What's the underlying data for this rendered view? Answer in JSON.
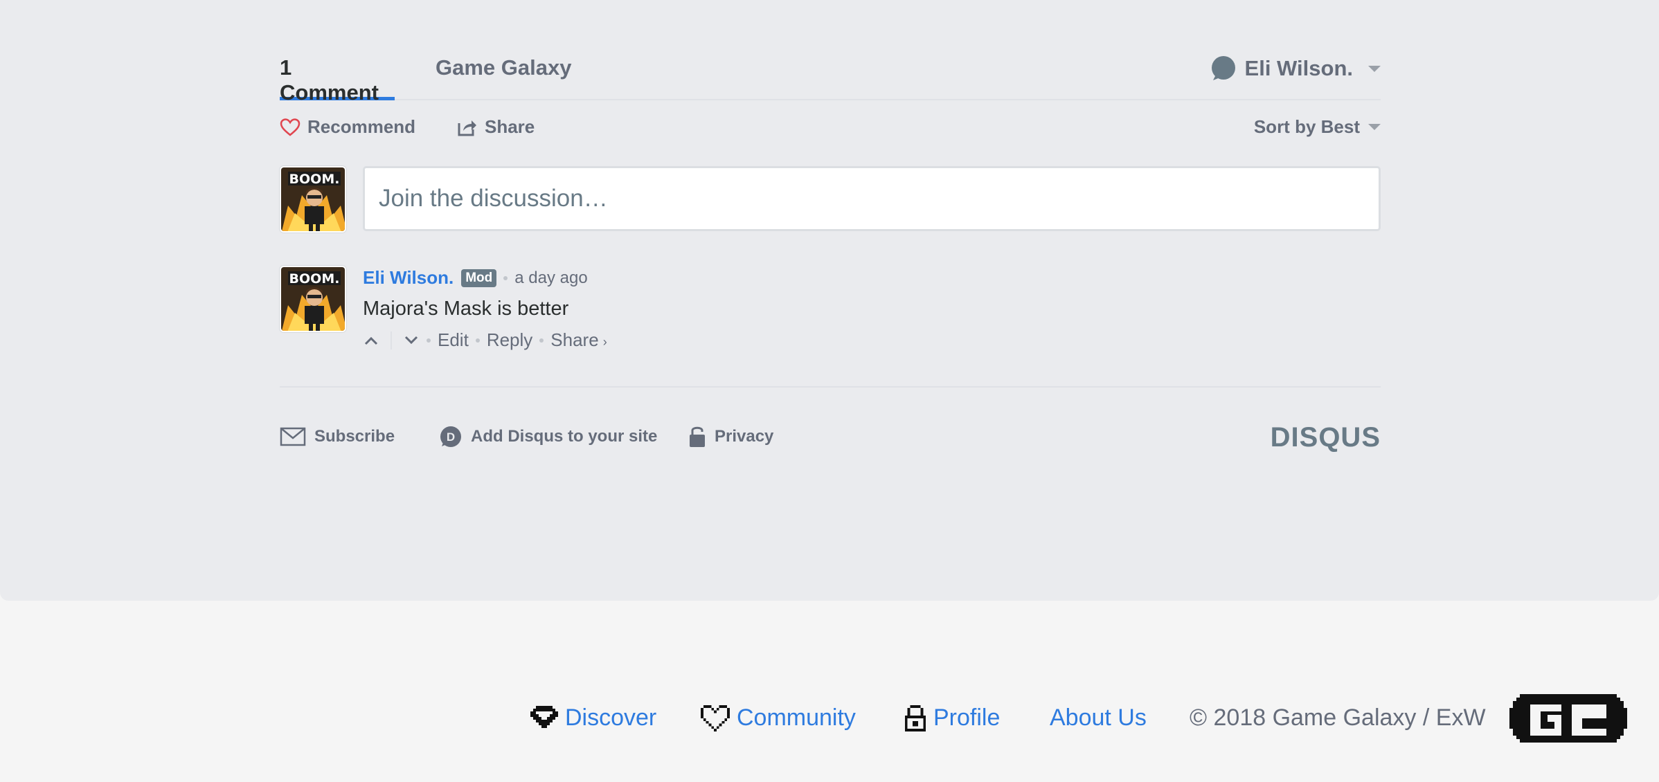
{
  "nav": {
    "tabs": [
      {
        "label": "1 Comment",
        "active": true
      },
      {
        "label": "Game Galaxy",
        "active": false
      }
    ],
    "user": {
      "name": "Eli Wilson.",
      "icon": "speech-bubble-icon"
    }
  },
  "actions": {
    "recommend": "Recommend",
    "share": "Share",
    "sort": "Sort by Best"
  },
  "composer": {
    "placeholder": "Join the discussion…"
  },
  "comment": {
    "author": "Eli Wilson.",
    "badge": "Mod",
    "time": "a day ago",
    "body": "Majora's Mask is better",
    "edit": "Edit",
    "reply": "Reply",
    "share": "Share",
    "share_arrow": "›"
  },
  "disqus_footer": {
    "subscribe": "Subscribe",
    "add": "Add Disqus to your site",
    "privacy": "Privacy",
    "logo": "DISQUS"
  },
  "site_footer": {
    "discover": "Discover",
    "community": "Community",
    "profile": "Profile",
    "about": "About Us",
    "copyright": "© 2018 Game Galaxy / ExW"
  },
  "colors": {
    "accent": "#2e7bdf",
    "panel_bg": "#eaebee",
    "page_bg": "#f5f5f5",
    "muted": "#656c7a",
    "heart": "#e0454f"
  }
}
